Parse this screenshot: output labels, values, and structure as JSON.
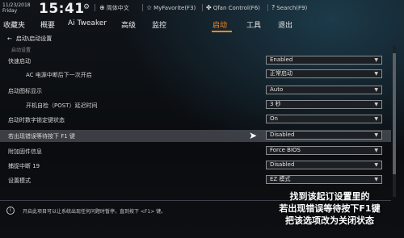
{
  "header": {
    "date": "11/23/2018",
    "day": "Friday",
    "time": "15:41",
    "gear_icon": "gear-icon",
    "tools": [
      {
        "glyph": "⊕",
        "label": "简体中文"
      },
      {
        "glyph": "☆",
        "label": "MyFavorite(F3)"
      },
      {
        "glyph": "✤",
        "label": "Qfan Control(F6)"
      },
      {
        "glyph": "?",
        "label": "Search(F9)"
      }
    ]
  },
  "menu": {
    "items": [
      "收藏夹",
      "概要",
      "Ai Tweaker",
      "高级",
      "监控",
      "启动",
      "工具",
      "退出"
    ],
    "active_index": 5,
    "accent_color": "#ff8c1a"
  },
  "breadcrumb": "启动\\启动设置",
  "section_label": "启动设置",
  "settings": [
    {
      "label": "快速启动",
      "value": "Enabled"
    },
    {
      "label": "AC 电源中断后下一次开启",
      "value": "正常启动"
    },
    {
      "label": "启动图标显示",
      "value": "Auto"
    },
    {
      "label": "开机自检（POST）延迟时间",
      "value": "3 秒"
    },
    {
      "label": "启动时数字锁定键状态",
      "value": "On"
    },
    {
      "label": "若出现错误等待按下 F1 键",
      "value": "Disabled"
    },
    {
      "label": "附加固件信息",
      "value": "Force BIOS"
    },
    {
      "label": "捕捉中断 19",
      "value": "Disabled"
    },
    {
      "label": "设置模式",
      "value": "EZ 模式"
    }
  ],
  "highlighted_index": 5,
  "info_text": "开启此项目可以让系统出现任何问题时暂停，直到按下 <F1> 键。",
  "caption": {
    "line1": "找到该起订设置里的",
    "line2": "若出现错误等待按下F1键",
    "line3": "把该选项改为关闭状态"
  }
}
